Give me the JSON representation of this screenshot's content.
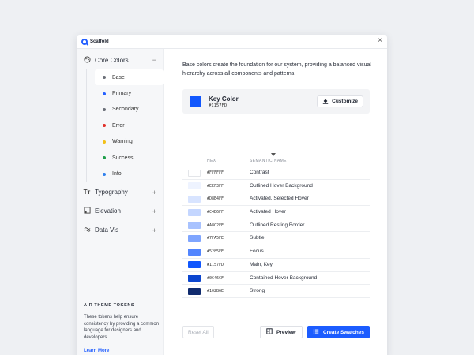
{
  "app": {
    "title": "Scaffold"
  },
  "sidebar": {
    "groups": [
      {
        "label": "Core Colors",
        "icon": "palette-icon",
        "toggle": "−"
      },
      {
        "label": "Typography",
        "icon": "text-icon",
        "toggle": "+"
      },
      {
        "label": "Elevation",
        "icon": "layers-icon",
        "toggle": "+"
      },
      {
        "label": "Data Vis",
        "icon": "wave-icon",
        "toggle": "+"
      }
    ],
    "core_items": [
      {
        "label": "Base",
        "color": "#6b6f78"
      },
      {
        "label": "Primary",
        "color": "#2460ff"
      },
      {
        "label": "Secondary",
        "color": "#6b6f78"
      },
      {
        "label": "Error",
        "color": "#e0302a"
      },
      {
        "label": "Warning",
        "color": "#f2c018"
      },
      {
        "label": "Success",
        "color": "#1e9e4a"
      },
      {
        "label": "Info",
        "color": "#2f80ed"
      }
    ],
    "tokens_title": "AIR THEME TOKENS",
    "tokens_desc": "These tokens help ensure consistency by providing a common language for designers and developers.",
    "learn_more": "Learn More"
  },
  "main": {
    "description": "Base colors create the foundation for our system, providing a balanced visual hierarchy across all components and patterns.",
    "key_color": {
      "label": "Key Color",
      "hex": "#1157FD"
    },
    "customize_label": "Customize",
    "columns": {
      "hex": "HEX",
      "name": "SEMANTIC NAME"
    },
    "swatches": [
      {
        "hex": "#FFFFFF",
        "name": "Contrast"
      },
      {
        "hex": "#EEF3FF",
        "name": "Outlined Hover Background"
      },
      {
        "hex": "#D8E4FF",
        "name": "Activated, Selected Hover"
      },
      {
        "hex": "#C4D6FF",
        "name": "Activated Hover"
      },
      {
        "hex": "#A8C2FE",
        "name": "Outlined Resting Border"
      },
      {
        "hex": "#7FA5FE",
        "name": "Subtle"
      },
      {
        "hex": "#5285FE",
        "name": "Focus"
      },
      {
        "hex": "#1157FD",
        "name": "Main, Key"
      },
      {
        "hex": "#0C46CF",
        "name": "Contained Hover Background"
      },
      {
        "hex": "#102B6E",
        "name": "Strong"
      }
    ]
  },
  "footer": {
    "reset_label": "Reset All",
    "preview_label": "Preview",
    "create_label": "Create Swatches"
  }
}
